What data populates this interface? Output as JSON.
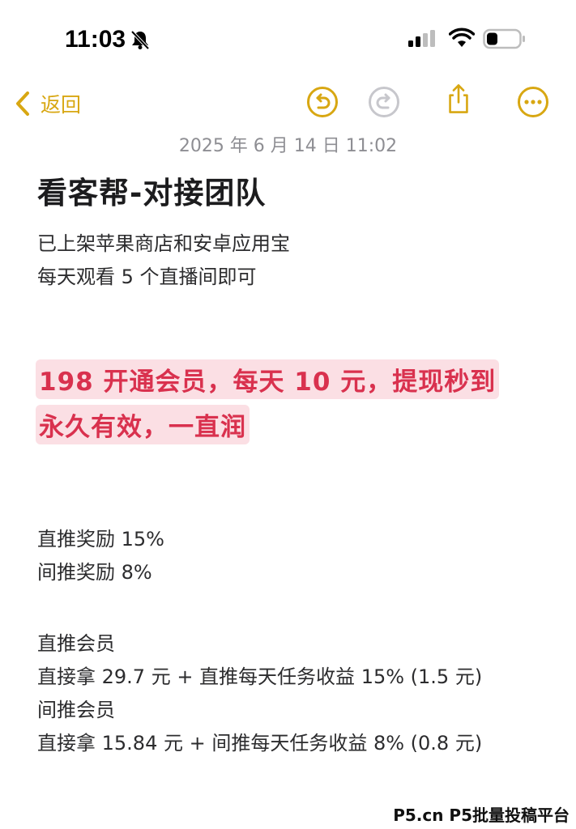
{
  "status_bar": {
    "time": "11:03",
    "icons": [
      "bell-slash-icon",
      "signal-icon",
      "wifi-icon",
      "battery-icon"
    ]
  },
  "toolbar": {
    "back_label": "返回",
    "icons": [
      "chevron-left-icon",
      "undo-icon",
      "redo-icon",
      "share-icon",
      "more-icon"
    ],
    "accent_color": "#d8a712"
  },
  "note": {
    "date": "2025 年 6 月 14 日 11:02",
    "title": "看客帮-对接团队",
    "intro_lines": [
      "已上架苹果商店和安卓应用宝",
      "每天观看 5 个直播间即可"
    ],
    "highlight_lines": [
      "198 开通会员，每天 10 元，提现秒到",
      "永久有效，一直润"
    ],
    "reward_lines": [
      "直推奖励 15%",
      "间推奖励 8%"
    ],
    "member_lines": [
      "直推会员",
      "直接拿 29.7 元 + 直推每天任务收益 15% (1.5 元)",
      "间推会员",
      "直接拿 15.84 元 + 间推每天任务收益 8% (0.8 元)"
    ],
    "highlight_bg": "#fbdfe4",
    "highlight_text_color": "#d9314e"
  },
  "watermark": "P5.cn P5批量投稿平台"
}
